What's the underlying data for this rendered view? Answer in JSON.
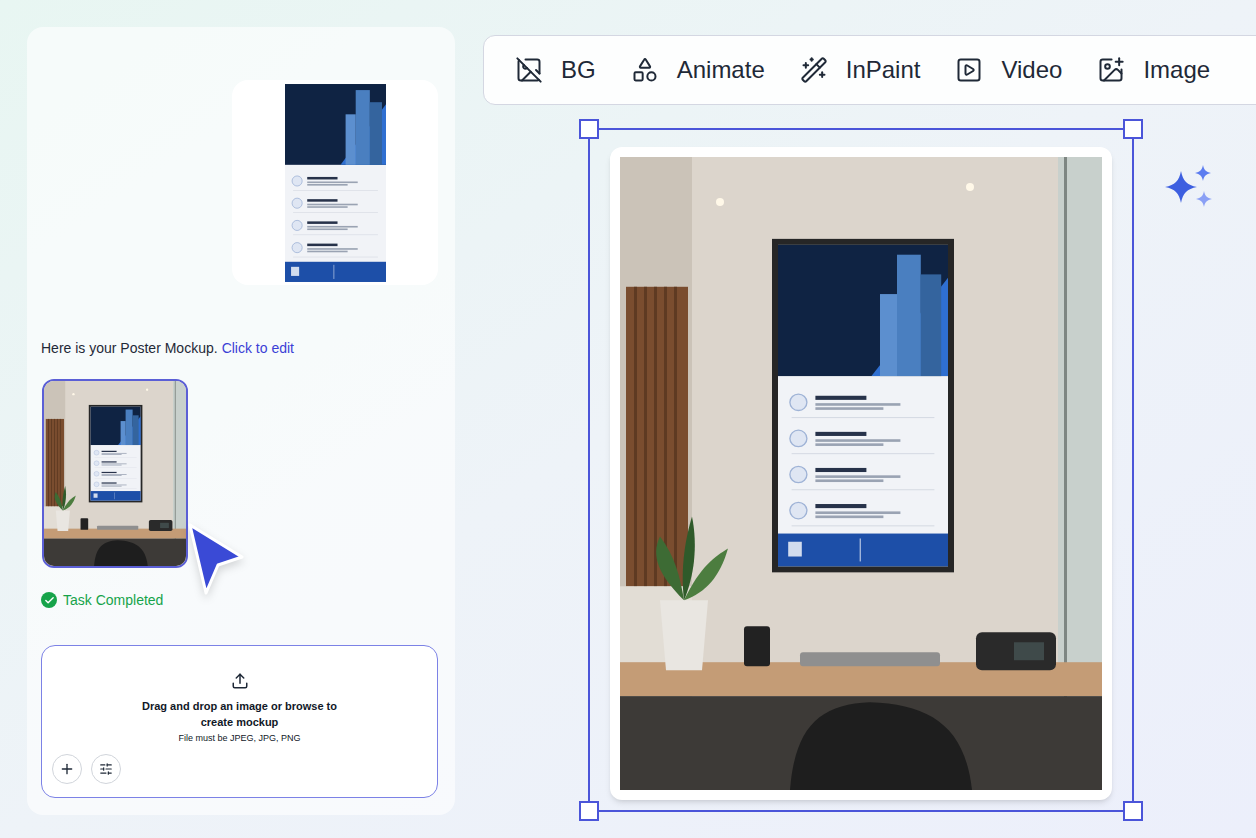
{
  "toolbar": [
    {
      "label": "BG"
    },
    {
      "label": "Animate"
    },
    {
      "label": "InPaint"
    },
    {
      "label": "Video"
    },
    {
      "label": "Image"
    }
  ],
  "chat": {
    "message": "Here is your Poster Mockup.",
    "edit_link": "Click to edit",
    "status": "Task Completed",
    "status_done": true,
    "thumbnail_selected": true
  },
  "upload": {
    "title": "Drag and drop an image or browse to create mockup",
    "hint": "File must be JPEG, JPG, PNG"
  },
  "canvas": {
    "selected": true
  }
}
